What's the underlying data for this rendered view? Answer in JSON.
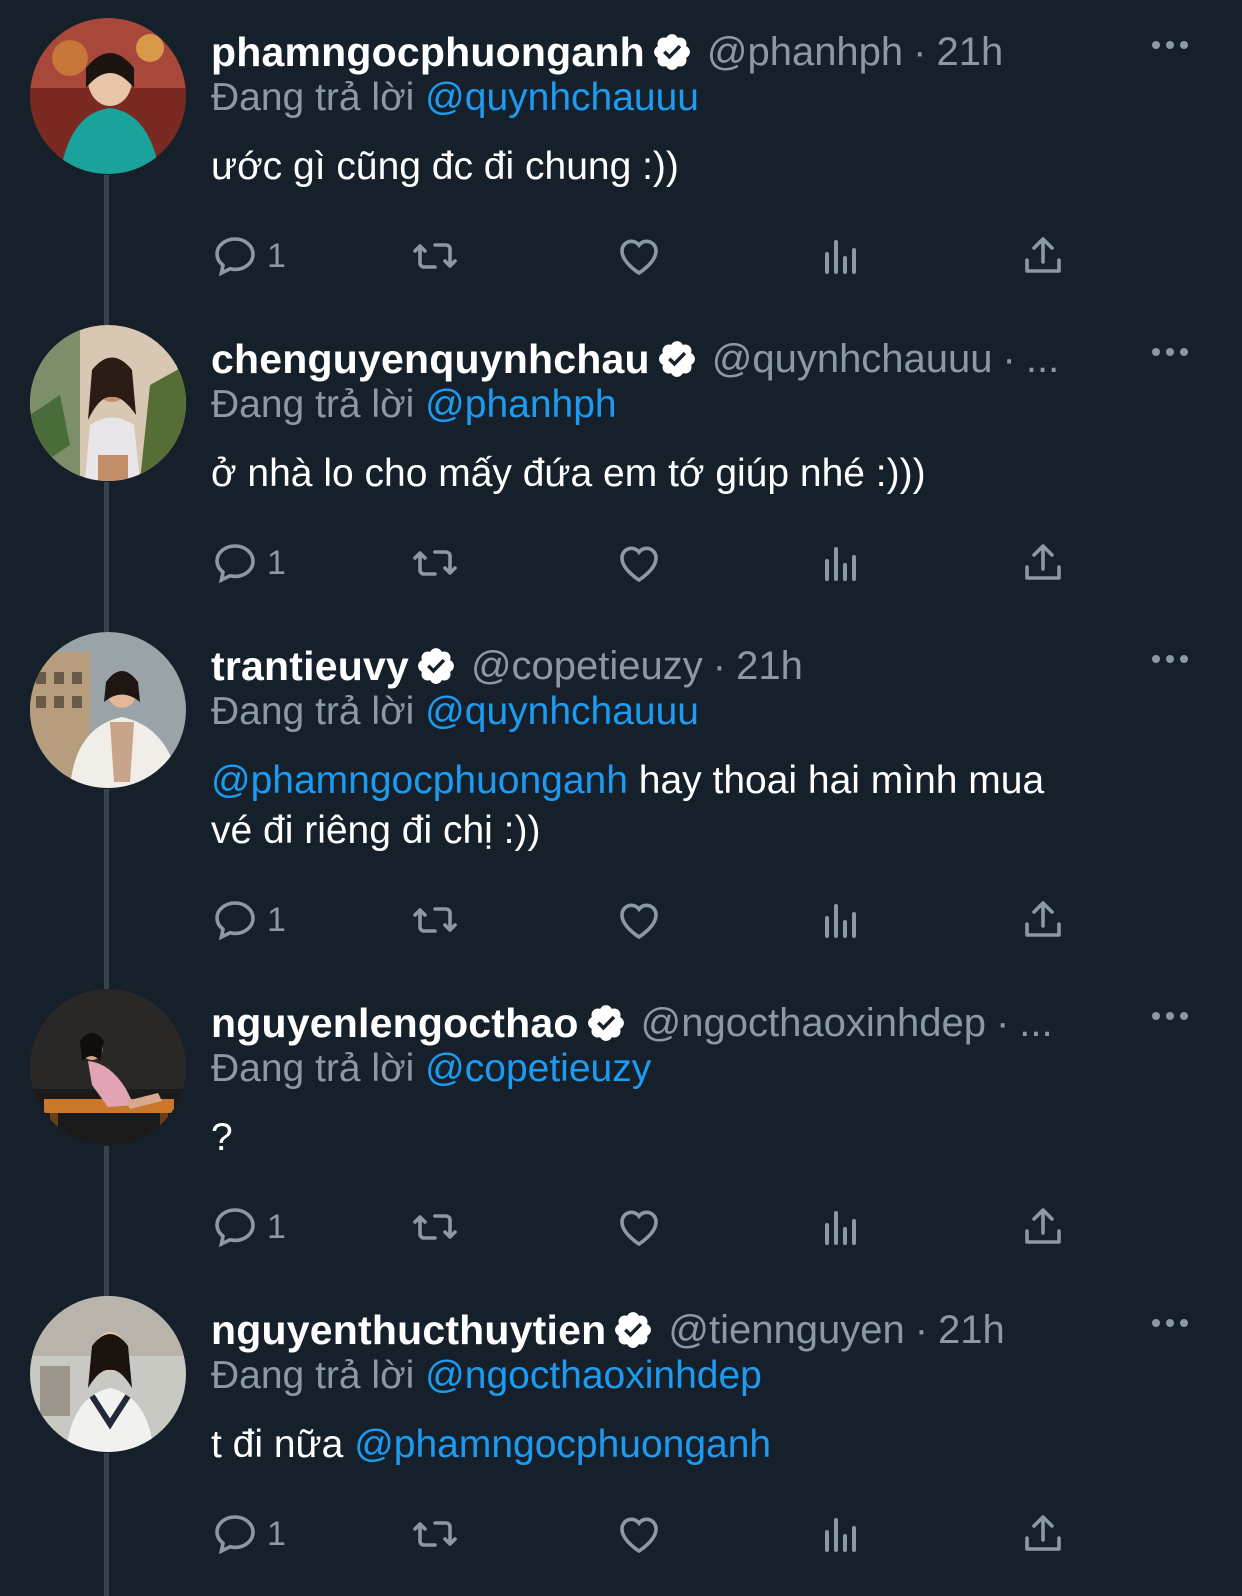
{
  "colors": {
    "background": "#15202b",
    "text_primary": "#ffffff",
    "text_secondary": "#8b98a5",
    "accent": "#1d9bf0",
    "thread_line": "#38444d"
  },
  "reply_prefix": "Đang trả lời",
  "icons": {
    "reply": "reply-icon",
    "retweet": "retweet-icon",
    "like": "like-icon",
    "views": "views-icon",
    "share": "share-icon",
    "more": "more-icon",
    "verified": "verified-badge-icon"
  },
  "tweets": [
    {
      "name": "phamngocphuonganh",
      "handle": "@phanhph",
      "dot": "·",
      "time": "21h",
      "replying_to": "@quynhchauuu",
      "text_mention": "",
      "text": "ước gì cũng đc đi chung :))",
      "text_line2": "",
      "reply_count": "1"
    },
    {
      "name": "chenguyenquynhchau",
      "handle": "@quynhchauuu",
      "dot": "·",
      "time": "...",
      "replying_to": "@phanhph",
      "text_mention": "",
      "text": "ở nhà lo cho mấy đứa em tớ giúp nhé :)))",
      "text_line2": "",
      "reply_count": "1"
    },
    {
      "name": "trantieuvy",
      "handle": "@copetieuzy",
      "dot": "·",
      "time": "21h",
      "replying_to": "@quynhchauuu",
      "text_mention": "@phamngocphuonganh",
      "text": " hay thoai hai mình mua",
      "text_line2": "vé đi riêng đi chị :))",
      "reply_count": "1"
    },
    {
      "name": "nguyenlengocthao",
      "handle": "@ngocthaoxinhdep",
      "dot": "·",
      "time": "...",
      "replying_to": "@copetieuzy",
      "text_mention": "",
      "text": "?",
      "text_line2": "",
      "reply_count": "1"
    },
    {
      "name": "nguyenthucthuytien",
      "handle": "@tiennguyen",
      "dot": "·",
      "time": "21h",
      "replying_to": "@ngocthaoxinhdep",
      "text_mention": "",
      "text": "t đi nữa ",
      "text_tail_mention": "@phamngocphuonganh",
      "text_line2": "",
      "reply_count": "1"
    }
  ]
}
